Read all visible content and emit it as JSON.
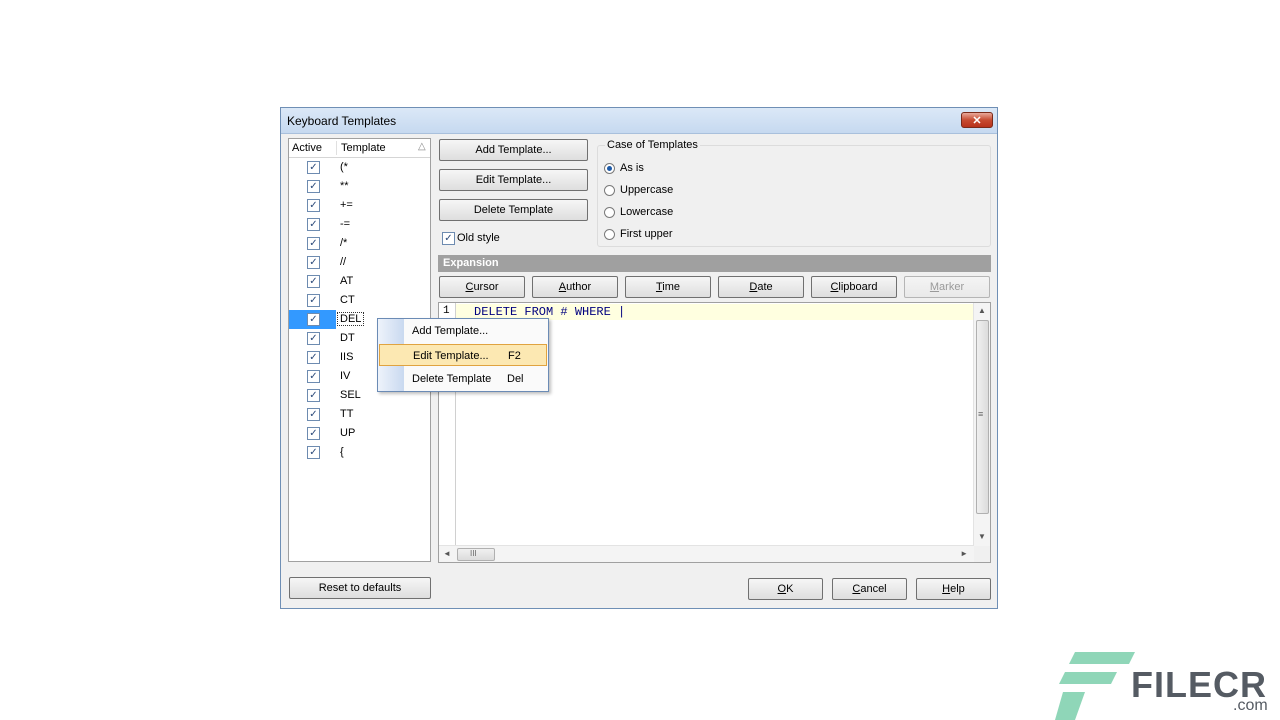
{
  "dialog": {
    "title": "Keyboard Templates",
    "close_glyph": "✕"
  },
  "list": {
    "header": {
      "active": "Active",
      "template": "Template",
      "sort_glyph": "△"
    },
    "check_glyph": "✓",
    "rows": [
      {
        "name": "(*",
        "checked": true
      },
      {
        "name": "**",
        "checked": true
      },
      {
        "name": "+=",
        "checked": true
      },
      {
        "name": "-=",
        "checked": true
      },
      {
        "name": "/*",
        "checked": true
      },
      {
        "name": "//",
        "checked": true
      },
      {
        "name": "AT",
        "checked": true
      },
      {
        "name": "CT",
        "checked": true
      },
      {
        "name": "DEL",
        "checked": true,
        "selected": true
      },
      {
        "name": "DT",
        "checked": true
      },
      {
        "name": "IIS",
        "checked": true
      },
      {
        "name": "IV",
        "checked": true
      },
      {
        "name": "SEL",
        "checked": true
      },
      {
        "name": "TT",
        "checked": true
      },
      {
        "name": "UP",
        "checked": true
      },
      {
        "name": "{",
        "checked": true
      }
    ]
  },
  "actions": {
    "add": "Add Template...",
    "edit": "Edit Template...",
    "delete": "Delete Template",
    "old_style": "Old style"
  },
  "case": {
    "title": "Case of Templates",
    "options": [
      "As is",
      "Uppercase",
      "Lowercase",
      "First upper"
    ],
    "selected_index": 0
  },
  "expansion": {
    "title": "Expansion",
    "buttons": [
      {
        "pre": "",
        "u": "C",
        "post": "ursor",
        "disabled": false
      },
      {
        "pre": "",
        "u": "A",
        "post": "uthor",
        "disabled": false
      },
      {
        "pre": "",
        "u": "T",
        "post": "ime",
        "disabled": false
      },
      {
        "pre": "",
        "u": "D",
        "post": "ate",
        "disabled": false
      },
      {
        "pre": "",
        "u": "C",
        "post": "lipboard",
        "disabled": false
      },
      {
        "pre": "",
        "u": "M",
        "post": "arker",
        "disabled": true
      }
    ]
  },
  "editor": {
    "line_number": "1",
    "code": "DELETE FROM # WHERE |",
    "grip_v": "≡",
    "grip_h": "III"
  },
  "context_menu": {
    "items": [
      {
        "label": "Add Template...",
        "shortcut": ""
      },
      {
        "label": "Edit Template...",
        "shortcut": "F2",
        "highlighted": true
      },
      {
        "label": "Delete Template",
        "shortcut": "Del"
      }
    ]
  },
  "footer": {
    "reset": "Reset to defaults",
    "ok": {
      "u": "O",
      "post": "K"
    },
    "cancel": {
      "u": "C",
      "post": "ancel"
    },
    "help": {
      "u": "H",
      "post": "elp"
    }
  },
  "watermark": {
    "brand": "FILECR",
    "domain": ".com",
    "logo_color": "#8fd6b8"
  }
}
